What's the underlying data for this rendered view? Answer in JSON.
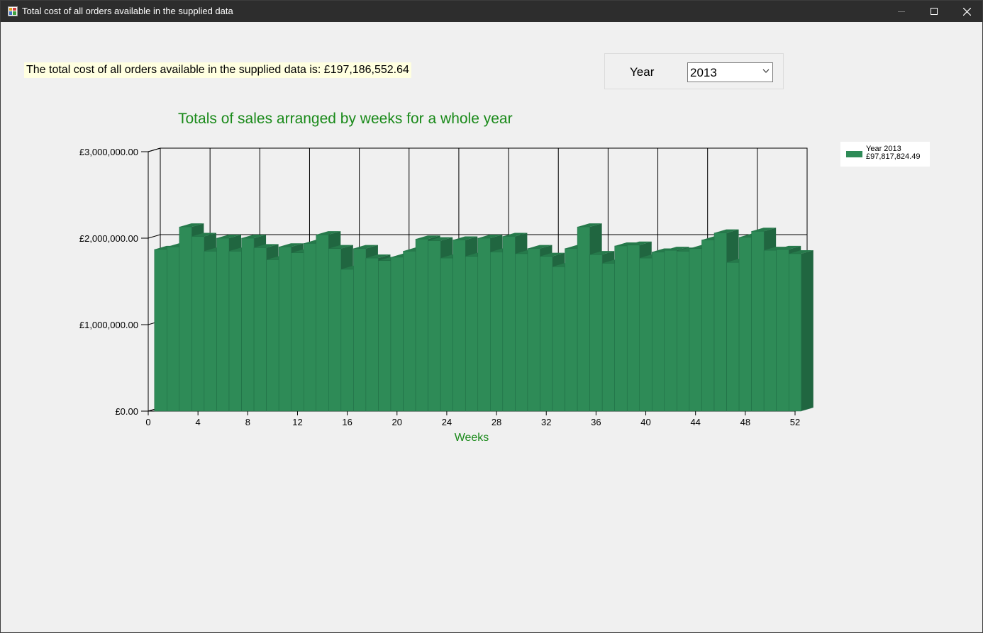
{
  "window": {
    "title": "Total cost of all orders available in the supplied data"
  },
  "summary": {
    "text": "The total cost of all orders available in the supplied data is: £197,186,552.64"
  },
  "year_filter": {
    "label": "Year",
    "selected": "2013"
  },
  "chart_title": "Totals of sales arranged by weeks for a whole year",
  "legend": {
    "name": "Year 2013",
    "total": "£97,817,824.49"
  },
  "colors": {
    "bar": "#2e8b57",
    "bar_side": "#206640",
    "bar_top": "#267a4b",
    "title": "#1a8a1a"
  },
  "chart_data": {
    "type": "bar",
    "title": "Totals of sales arranged by weeks for a whole year",
    "xlabel": "Weeks",
    "ylabel": "",
    "x": [
      1,
      2,
      3,
      4,
      5,
      6,
      7,
      8,
      9,
      10,
      11,
      12,
      13,
      14,
      15,
      16,
      17,
      18,
      19,
      20,
      21,
      22,
      23,
      24,
      25,
      26,
      27,
      28,
      29,
      30,
      31,
      32,
      33,
      34,
      35,
      36,
      37,
      38,
      39,
      40,
      41,
      42,
      43,
      44,
      45,
      46,
      47,
      48,
      49,
      50,
      51,
      52
    ],
    "series": [
      {
        "name": "Year 2013",
        "values": [
          1870000,
          1900000,
          2130000,
          2020000,
          1850000,
          2000000,
          1850000,
          2000000,
          1890000,
          1750000,
          1900000,
          1830000,
          1940000,
          2040000,
          1880000,
          1640000,
          1880000,
          1770000,
          1740000,
          1780000,
          1850000,
          1990000,
          1970000,
          1770000,
          1980000,
          1790000,
          2000000,
          1840000,
          2020000,
          1820000,
          1880000,
          1790000,
          1670000,
          1880000,
          2130000,
          1810000,
          1710000,
          1910000,
          1920000,
          1770000,
          1840000,
          1860000,
          1850000,
          1880000,
          1980000,
          2060000,
          1720000,
          2010000,
          2080000,
          1860000,
          1870000,
          1820000
        ]
      }
    ],
    "ylim": [
      0,
      3000000
    ],
    "xlim": [
      0,
      52
    ],
    "y_ticks": [
      "£0.00",
      "£1,000,000.00",
      "£2,000,000.00",
      "£3,000,000.00"
    ],
    "x_ticks": [
      "0",
      "4",
      "8",
      "12",
      "16",
      "20",
      "24",
      "28",
      "32",
      "36",
      "40",
      "44",
      "48",
      "52"
    ],
    "grid": true,
    "legend_position": "top-right"
  }
}
